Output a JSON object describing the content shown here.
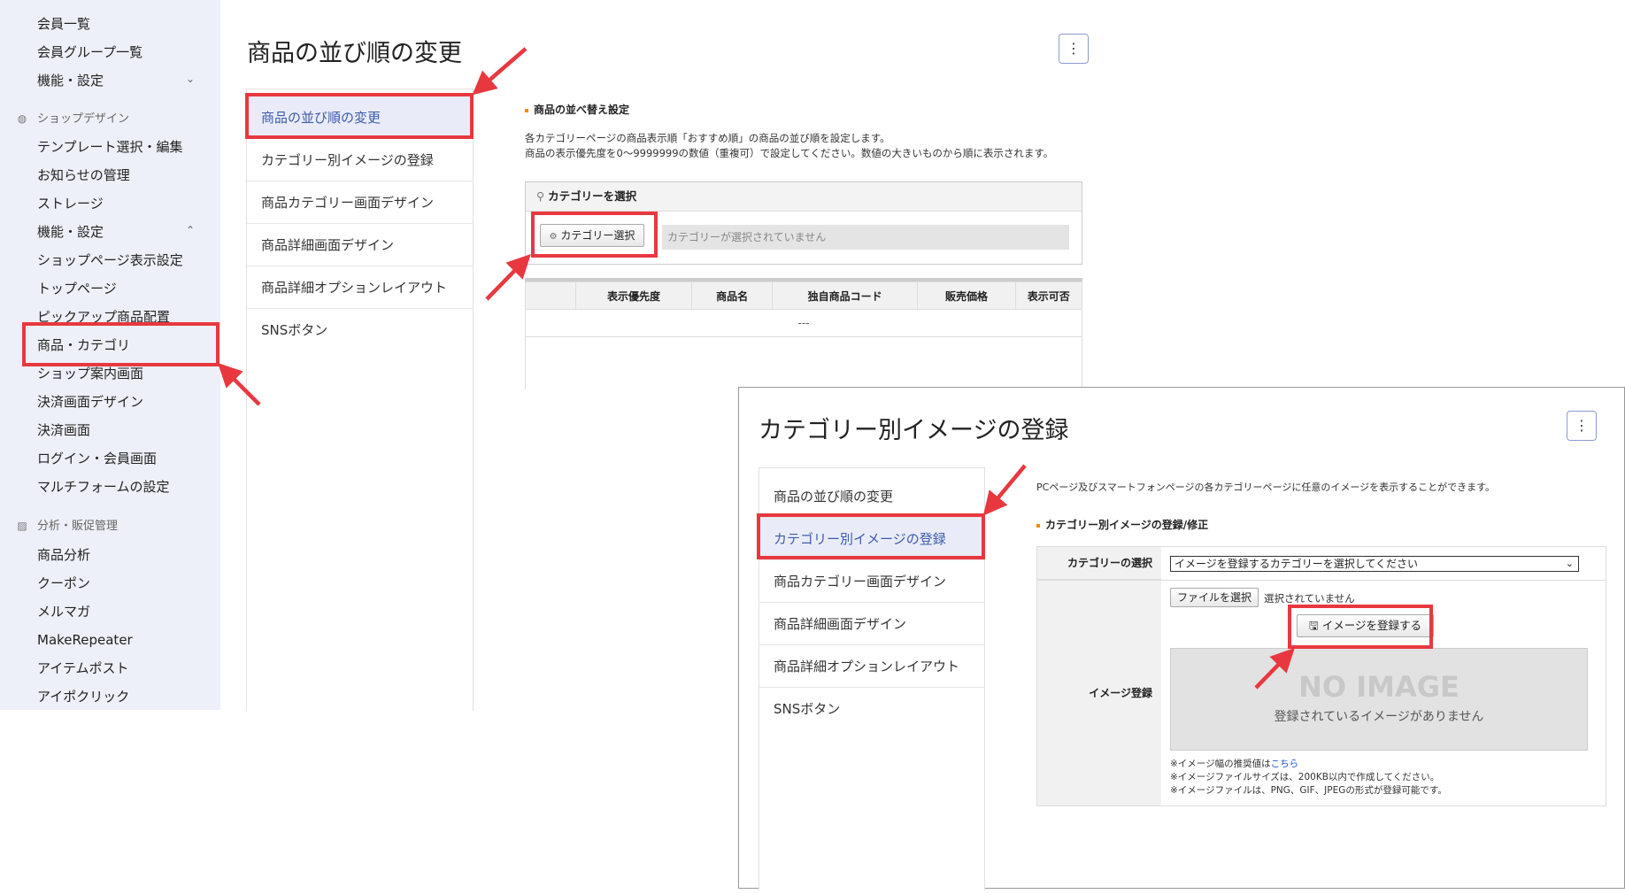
{
  "sidebar": {
    "members": {
      "list": "会員一覧",
      "groups": "会員グループ一覧",
      "settings": "機能・設定"
    },
    "shop_design": {
      "heading": "ショップデザイン",
      "items": [
        "テンプレート選択・編集",
        "お知らせの管理",
        "ストレージ",
        "機能・設定",
        "ショップページ表示設定",
        "トップページ",
        "ピックアップ商品配置",
        "商品・カテゴリ",
        "ショップ案内画面",
        "決済画面デザイン",
        "決済画面",
        "ログイン・会員画面",
        "マルチフォームの設定"
      ]
    },
    "analytics": {
      "heading": "分析・販促管理",
      "items": [
        "商品分析",
        "クーポン",
        "メルマガ",
        "MakeRepeater",
        "アイテムポスト",
        "アイポクリック"
      ]
    }
  },
  "main": {
    "title": "商品の並び順の変更",
    "kebab": "⋮",
    "menu": [
      "商品の並び順の変更",
      "カテゴリー別イメージの登録",
      "商品カテゴリー画面デザイン",
      "商品詳細画面デザイン",
      "商品詳細オプションレイアウト",
      "SNSボタン"
    ],
    "section_title": "商品の並べ替え設定",
    "desc1": "各カテゴリーページの商品表示順「おすすめ順」の商品の並び順を設定します。",
    "desc2": "商品の表示優先度を0～9999999の数値（重複可）で設定してください。数値の大きいものから順に表示されます。",
    "category_panel_title": "カテゴリーを選択",
    "category_button": "カテゴリー選択",
    "category_placeholder": "カテゴリーが選択されていません",
    "table_headers": [
      "表示優先度",
      "商品名",
      "独自商品コード",
      "販売価格",
      "表示可否"
    ],
    "table_empty": "---"
  },
  "overlay": {
    "title": "カテゴリー別イメージの登録",
    "kebab": "⋮",
    "menu": [
      "商品の並び順の変更",
      "カテゴリー別イメージの登録",
      "商品カテゴリー画面デザイン",
      "商品詳細画面デザイン",
      "商品詳細オプションレイアウト",
      "SNSボタン"
    ],
    "desc": "PCページ及びスマートフォンページの各カテゴリーページに任意のイメージを表示することができます。",
    "section_title": "カテゴリー別イメージの登録/修正",
    "label_category": "カテゴリーの選択",
    "select_value": "イメージを登録するカテゴリーを選択してください",
    "label_image": "イメージ登録",
    "file_button": "ファイルを選択",
    "file_status": "選択されていません",
    "register_button": "イメージを登録する",
    "noimage_big": "NO IMAGE",
    "noimage_sub": "登録されているイメージがありません",
    "note1_prefix": "※イメージ幅の推奨値は",
    "note1_link": "こちら",
    "note2": "※イメージファイルサイズは、200KB以内で作成してください。",
    "note3": "※イメージファイルは、PNG、GIF、JPEGの形式が登録可能です。"
  },
  "colors": {
    "highlight": "#e8383f",
    "sidebar_bg": "#edf0f8",
    "active_menu_bg": "#e9ecf8",
    "accent_orange": "#f08a00"
  }
}
